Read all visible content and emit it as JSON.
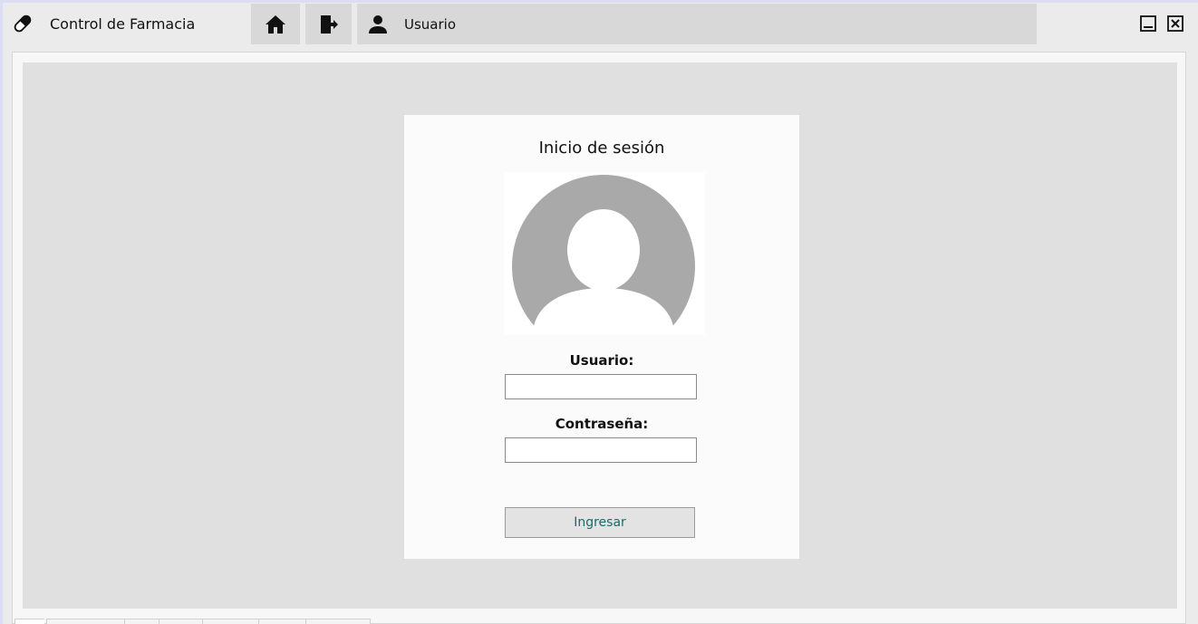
{
  "window": {
    "title": "Control de Farmacia",
    "icons": {
      "app": "pill-icon",
      "minimize": "minimize-icon",
      "close": "close-icon"
    }
  },
  "nav": {
    "home_icon": "home-icon",
    "logout_icon": "logout-icon",
    "user_icon": "person-icon",
    "user_label": "Usuario"
  },
  "login": {
    "title": "Inicio de sesión",
    "avatar_icon": "user-avatar-icon",
    "username_label": "Usuario:",
    "username_value": "",
    "password_label": "Contraseña:",
    "password_value": "",
    "submit_label": "Ingresar"
  },
  "colors": {
    "titlebar_bg": "#ebebeb",
    "nav_button_bg": "#d8d8d8",
    "content_bg": "#e0e0e0",
    "card_bg": "#fbfbfb",
    "avatar_gray": "#a9a9a9",
    "submit_text": "#1e6a6a"
  }
}
